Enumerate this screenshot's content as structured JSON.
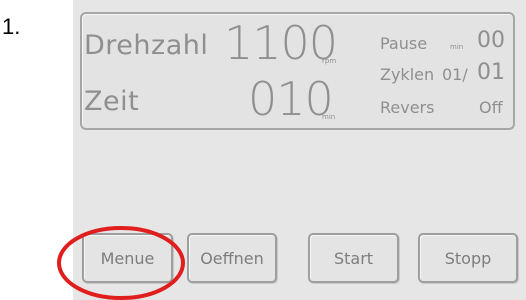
{
  "step_number": "1.",
  "display": {
    "speed": {
      "label": "Drehzahl",
      "value": "1100",
      "unit": "rpm"
    },
    "time": {
      "label": "Zeit",
      "value": "010",
      "unit": "min"
    },
    "pause": {
      "label": "Pause",
      "unit": "min",
      "value": "00"
    },
    "cycles": {
      "label": "Zyklen",
      "value": "01/",
      "total": "01"
    },
    "reverse": {
      "label": "Revers",
      "value": "Off"
    }
  },
  "buttons": {
    "menu": "Menue",
    "open": "Oeffnen",
    "start": "Start",
    "stop": "Stopp"
  },
  "annotation_color": "#e01e1e"
}
